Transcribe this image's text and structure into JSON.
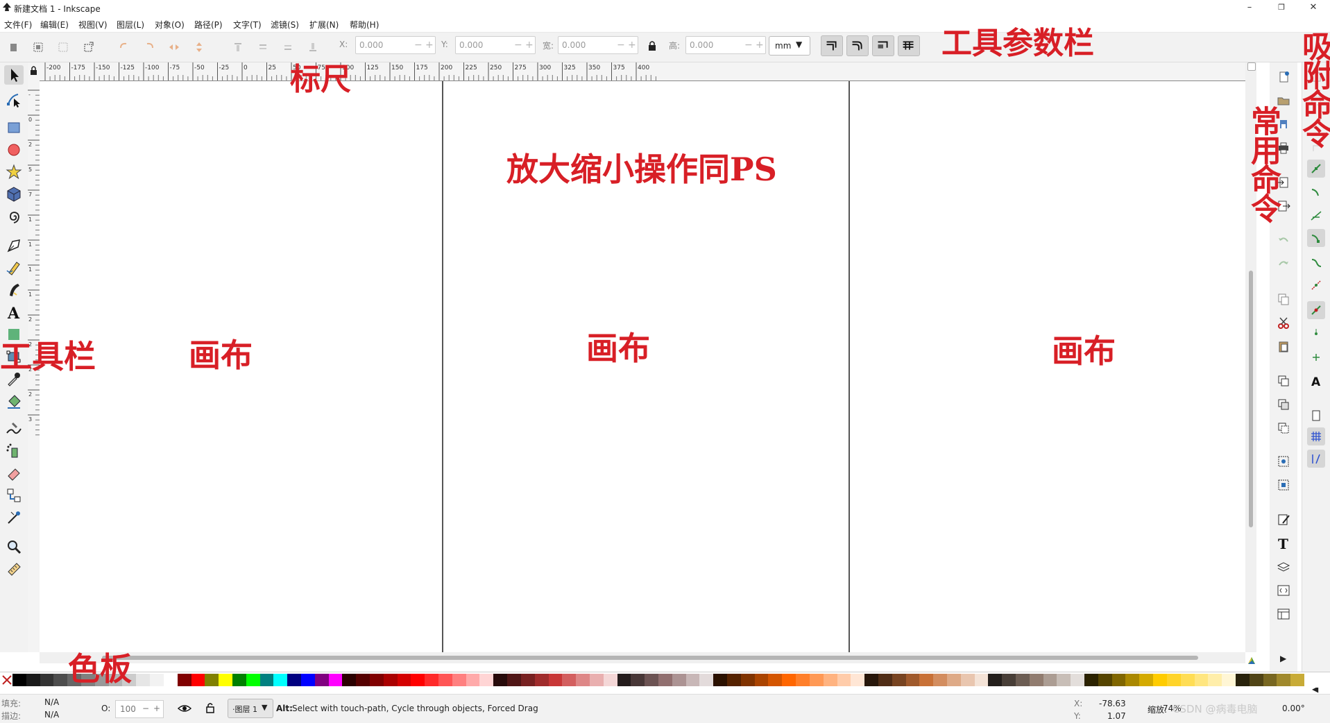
{
  "window": {
    "title": "新建文档 1 - Inkscape",
    "minimize_label": "–",
    "maximize_label": "❐",
    "close_label": "✕"
  },
  "menu": [
    "文件(F)",
    "编辑(E)",
    "视图(V)",
    "图层(L)",
    "对象(O)",
    "路径(P)",
    "文字(T)",
    "滤镜(S)",
    "扩展(N)",
    "帮助(H)"
  ],
  "controls": {
    "x_label": "X:",
    "x_value": "0.000",
    "y_label": "Y:",
    "y_value": "0.000",
    "w_label": "宽:",
    "w_value": "0.000",
    "h_label": "高:",
    "h_value": "0.000",
    "unit": "mm"
  },
  "hruler_labels": [
    "-200",
    "-175",
    "-150",
    "-125",
    "-100",
    "-75",
    "-50",
    "-25",
    "0",
    "25",
    "50",
    "75",
    "100",
    "125",
    "150",
    "175",
    "200",
    "225",
    "250",
    "275",
    "300",
    "325",
    "350",
    "375",
    "400"
  ],
  "vruler_labels": [
    "-25",
    "0",
    "25",
    "50",
    "75",
    "100",
    "125",
    "150",
    "175",
    "200",
    "225",
    "250",
    "275",
    "300"
  ],
  "palette": [
    "#000000",
    "#1a1a1a",
    "#333333",
    "#4d4d4d",
    "#666666",
    "#808080",
    "#999999",
    "#b3b3b3",
    "#cccccc",
    "#e6e6e6",
    "#f2f2f2",
    "#ffffff",
    "#800000",
    "#ff0000",
    "#808000",
    "#ffff00",
    "#008000",
    "#00ff00",
    "#008080",
    "#00ffff",
    "#000080",
    "#0000ff",
    "#800080",
    "#ff00ff",
    "#2b0000",
    "#550000",
    "#800000",
    "#aa0000",
    "#d40000",
    "#ff0000",
    "#ff2a2a",
    "#ff5555",
    "#ff8080",
    "#ffaaaa",
    "#ffd5d5",
    "#280b0b",
    "#501616",
    "#782121",
    "#a02c2c",
    "#c83737",
    "#d35f5f",
    "#de8787",
    "#e9afaf",
    "#f4d7d7",
    "#241c1c",
    "#483737",
    "#6c5353",
    "#916f6f",
    "#ac9393",
    "#c8b7b7",
    "#e3dbdb",
    "#2b1100",
    "#552200",
    "#803300",
    "#aa4400",
    "#d45500",
    "#ff6600",
    "#ff7f2a",
    "#ff9955",
    "#ffb380",
    "#ffccaa",
    "#ffe6d5",
    "#28170b",
    "#502d16",
    "#784421",
    "#a05a2c",
    "#c87137",
    "#d38d5f",
    "#deaa87",
    "#e9c6af",
    "#f4e3d7",
    "#241f1c",
    "#483e37",
    "#6c5d53",
    "#917c6f",
    "#ac9d93",
    "#c8beb7",
    "#e3dedb",
    "#2b2200",
    "#554400",
    "#806600",
    "#aa8800",
    "#d4aa00",
    "#ffcc00",
    "#ffd42a",
    "#ffdd55",
    "#ffe680",
    "#ffeeaa",
    "#fff6d5",
    "#28220b",
    "#504416",
    "#786721",
    "#a0892c",
    "#c8ab37"
  ],
  "status": {
    "fill_label": "填充:",
    "fill_value": "N/A",
    "stroke_label": "描边:",
    "stroke_value": "N/A",
    "opacity_label": "O:",
    "opacity_value": "100",
    "layer": "·图层 1",
    "message_key": "Alt:",
    "message": " Select with touch-path, Cycle through objects, Forced Drag",
    "x_label": "X:",
    "x_value": "-78.63",
    "y_label": "Y:",
    "y_value": "1.07",
    "zoom_label": "缩放:",
    "zoom_value": "74%",
    "rotate_value": "0.00°",
    "watermark": "CSDN @病毒电脑"
  },
  "annotations": {
    "tool_params_bar": "工具参数栏",
    "ruler": "标尺",
    "snap_commands": "吸附命令",
    "common_commands": "常用命令",
    "zoom_note": "放大缩小操作同PS",
    "toolbar": "工具栏",
    "canvas_1": "画布",
    "canvas_2": "画布",
    "canvas_3": "画布",
    "palette": "色板"
  }
}
